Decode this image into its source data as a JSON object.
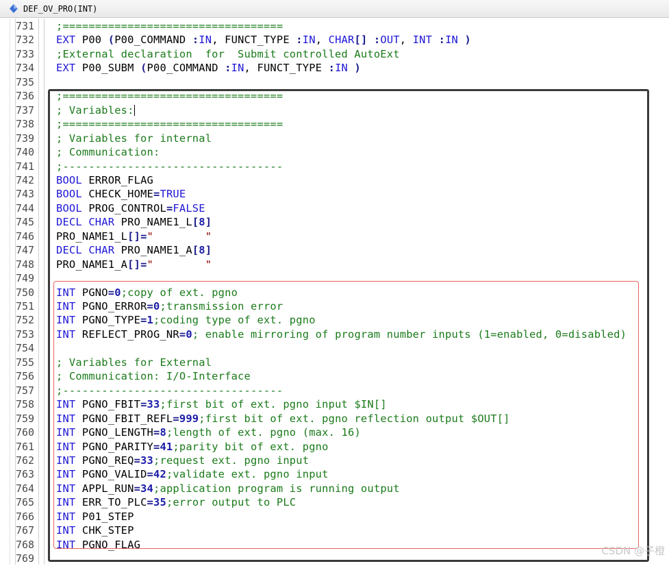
{
  "tab": {
    "title": "DEF_OV_PRO(INT)",
    "icon": "file-diamond-icon"
  },
  "colors": {
    "keyword": "#1e16d6",
    "comment": "#1a7a1a",
    "number": "#1a1aa8",
    "text": "#000000",
    "highlight_box": "#3a3a3a",
    "sub_box": "#e8625c"
  },
  "lines": [
    {
      "n": "731",
      "t": [
        [
          "cm",
          ";=================================="
        ]
      ]
    },
    {
      "n": "732",
      "t": [
        [
          "kw",
          "EXT"
        ],
        [
          "tx",
          " P00 "
        ],
        [
          "br",
          "("
        ],
        [
          "tx",
          "P00_COMMAND "
        ],
        [
          "br",
          ":"
        ],
        [
          "kw",
          "IN"
        ],
        [
          "tx",
          ", FUNCT_TYPE "
        ],
        [
          "br",
          ":"
        ],
        [
          "kw",
          "IN"
        ],
        [
          "tx",
          ", "
        ],
        [
          "kw",
          "CHAR"
        ],
        [
          "br",
          "[]"
        ],
        [
          "tx",
          " "
        ],
        [
          "br",
          ":"
        ],
        [
          "kw",
          "OUT"
        ],
        [
          "tx",
          ", "
        ],
        [
          "kw",
          "INT"
        ],
        [
          "tx",
          " "
        ],
        [
          "br",
          ":"
        ],
        [
          "kw",
          "IN"
        ],
        [
          "tx",
          " "
        ],
        [
          "br",
          ")"
        ]
      ]
    },
    {
      "n": "733",
      "t": [
        [
          "cm",
          ";External declaration  for  Submit controlled AutoExt"
        ]
      ]
    },
    {
      "n": "734",
      "t": [
        [
          "kw",
          "EXT"
        ],
        [
          "tx",
          " P00_SUBM "
        ],
        [
          "br",
          "("
        ],
        [
          "tx",
          "P00_COMMAND "
        ],
        [
          "br",
          ":"
        ],
        [
          "kw",
          "IN"
        ],
        [
          "tx",
          ", FUNCT_TYPE "
        ],
        [
          "br",
          ":"
        ],
        [
          "kw",
          "IN"
        ],
        [
          "tx",
          " "
        ],
        [
          "br",
          ")"
        ]
      ]
    },
    {
      "n": "735",
      "t": []
    },
    {
      "n": "736",
      "t": [
        [
          "cm",
          ";=================================="
        ]
      ]
    },
    {
      "n": "737",
      "t": [
        [
          "cm",
          "; Variables:"
        ]
      ],
      "caret": true
    },
    {
      "n": "738",
      "t": [
        [
          "cm",
          ";=================================="
        ]
      ]
    },
    {
      "n": "739",
      "t": [
        [
          "cm",
          "; Variables for internal"
        ]
      ]
    },
    {
      "n": "740",
      "t": [
        [
          "cm",
          "; Communication:"
        ]
      ]
    },
    {
      "n": "741",
      "t": [
        [
          "cm",
          ";----------------------------------"
        ]
      ]
    },
    {
      "n": "742",
      "t": [
        [
          "kw",
          "BOOL"
        ],
        [
          "tx",
          " ERROR_FLAG"
        ]
      ]
    },
    {
      "n": "743",
      "t": [
        [
          "kw",
          "BOOL"
        ],
        [
          "tx",
          " CHECK_HOME"
        ],
        [
          "br",
          "="
        ],
        [
          "kw",
          "TRUE"
        ]
      ]
    },
    {
      "n": "744",
      "t": [
        [
          "kw",
          "BOOL"
        ],
        [
          "tx",
          " PROG_CONTROL"
        ],
        [
          "br",
          "="
        ],
        [
          "kw",
          "FALSE"
        ]
      ]
    },
    {
      "n": "745",
      "t": [
        [
          "kw",
          "DECL"
        ],
        [
          "tx",
          " "
        ],
        [
          "kw",
          "CHAR"
        ],
        [
          "tx",
          " PRO_NAME1_L"
        ],
        [
          "br",
          "["
        ],
        [
          "num",
          "8"
        ],
        [
          "br",
          "]"
        ]
      ]
    },
    {
      "n": "746",
      "t": [
        [
          "tx",
          "PRO_NAME1_L"
        ],
        [
          "br",
          "[]="
        ],
        [
          "st",
          "\"        \""
        ]
      ]
    },
    {
      "n": "747",
      "t": [
        [
          "kw",
          "DECL"
        ],
        [
          "tx",
          " "
        ],
        [
          "kw",
          "CHAR"
        ],
        [
          "tx",
          " PRO_NAME1_A"
        ],
        [
          "br",
          "["
        ],
        [
          "num",
          "8"
        ],
        [
          "br",
          "]"
        ]
      ]
    },
    {
      "n": "748",
      "t": [
        [
          "tx",
          "PRO_NAME1_A"
        ],
        [
          "br",
          "[]="
        ],
        [
          "st",
          "\"        \""
        ]
      ]
    },
    {
      "n": "749",
      "t": []
    },
    {
      "n": "750",
      "t": [
        [
          "kw",
          "INT"
        ],
        [
          "tx",
          " PGNO"
        ],
        [
          "br",
          "="
        ],
        [
          "num",
          "0"
        ],
        [
          "cm",
          ";copy of ext. pgno"
        ]
      ]
    },
    {
      "n": "751",
      "t": [
        [
          "kw",
          "INT"
        ],
        [
          "tx",
          " PGNO_ERROR"
        ],
        [
          "br",
          "="
        ],
        [
          "num",
          "0"
        ],
        [
          "cm",
          ";transmission error"
        ]
      ]
    },
    {
      "n": "752",
      "t": [
        [
          "kw",
          "INT"
        ],
        [
          "tx",
          " PGNO_TYPE"
        ],
        [
          "br",
          "="
        ],
        [
          "num",
          "1"
        ],
        [
          "cm",
          ";coding type of ext. pgno"
        ]
      ]
    },
    {
      "n": "753",
      "t": [
        [
          "kw",
          "INT"
        ],
        [
          "tx",
          " REFLECT_PROG_NR"
        ],
        [
          "br",
          "="
        ],
        [
          "num",
          "0"
        ],
        [
          "cm",
          "; enable mirroring of program number inputs (1=enabled, 0=disabled)"
        ]
      ]
    },
    {
      "n": "754",
      "t": []
    },
    {
      "n": "755",
      "t": [
        [
          "cm",
          "; Variables for External"
        ]
      ]
    },
    {
      "n": "756",
      "t": [
        [
          "cm",
          "; Communication: I/O-Interface"
        ]
      ]
    },
    {
      "n": "757",
      "t": [
        [
          "cm",
          ";----------------------------------"
        ]
      ]
    },
    {
      "n": "758",
      "t": [
        [
          "kw",
          "INT"
        ],
        [
          "tx",
          " PGNO_FBIT"
        ],
        [
          "br",
          "="
        ],
        [
          "num",
          "33"
        ],
        [
          "cm",
          ";first bit of ext. pgno input $IN[]"
        ]
      ]
    },
    {
      "n": "759",
      "t": [
        [
          "kw",
          "INT"
        ],
        [
          "tx",
          " PGNO_FBIT_REFL"
        ],
        [
          "br",
          "="
        ],
        [
          "num",
          "999"
        ],
        [
          "cm",
          ";first bit of ext. pgno reflection output $OUT[]"
        ]
      ]
    },
    {
      "n": "760",
      "t": [
        [
          "kw",
          "INT"
        ],
        [
          "tx",
          " PGNO_LENGTH"
        ],
        [
          "br",
          "="
        ],
        [
          "num",
          "8"
        ],
        [
          "cm",
          ";length of ext. pgno (max. 16)"
        ]
      ]
    },
    {
      "n": "761",
      "t": [
        [
          "kw",
          "INT"
        ],
        [
          "tx",
          " PGNO_PARITY"
        ],
        [
          "br",
          "="
        ],
        [
          "num",
          "41"
        ],
        [
          "cm",
          ";parity bit of ext. pgno"
        ]
      ]
    },
    {
      "n": "762",
      "t": [
        [
          "kw",
          "INT"
        ],
        [
          "tx",
          " PGNO_REQ"
        ],
        [
          "br",
          "="
        ],
        [
          "num",
          "33"
        ],
        [
          "cm",
          ";request ext. pgno input"
        ]
      ]
    },
    {
      "n": "763",
      "t": [
        [
          "kw",
          "INT"
        ],
        [
          "tx",
          " PGNO_VALID"
        ],
        [
          "br",
          "="
        ],
        [
          "num",
          "42"
        ],
        [
          "cm",
          ";validate ext. pgno input"
        ]
      ]
    },
    {
      "n": "764",
      "t": [
        [
          "kw",
          "INT"
        ],
        [
          "tx",
          " APPL_RUN"
        ],
        [
          "br",
          "="
        ],
        [
          "num",
          "34"
        ],
        [
          "cm",
          ";application program is running output"
        ]
      ]
    },
    {
      "n": "765",
      "t": [
        [
          "kw",
          "INT"
        ],
        [
          "tx",
          " ERR_TO_PLC"
        ],
        [
          "br",
          "="
        ],
        [
          "num",
          "35"
        ],
        [
          "cm",
          ";error output to PLC"
        ]
      ]
    },
    {
      "n": "766",
      "t": [
        [
          "kw",
          "INT"
        ],
        [
          "tx",
          " P01_STEP"
        ]
      ]
    },
    {
      "n": "767",
      "t": [
        [
          "kw",
          "INT"
        ],
        [
          "tx",
          " CHK_STEP"
        ]
      ]
    },
    {
      "n": "768",
      "t": [
        [
          "kw",
          "INT"
        ],
        [
          "tx",
          " PGNO_FLAG"
        ]
      ]
    },
    {
      "n": "769",
      "t": []
    }
  ],
  "watermark": "CSDN @子橙"
}
